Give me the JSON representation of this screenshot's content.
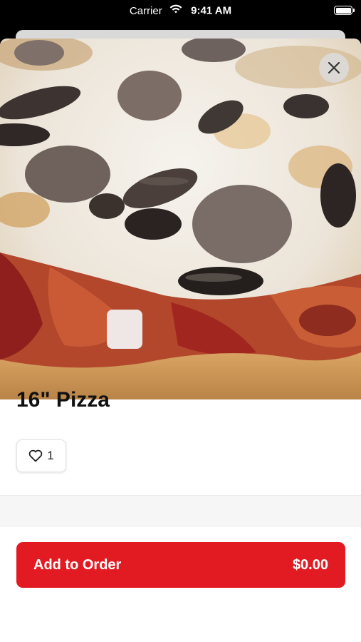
{
  "status_bar": {
    "carrier": "Carrier",
    "time": "9:41 AM",
    "icons": [
      "wifi-icon",
      "battery-icon"
    ]
  },
  "product": {
    "image_description_icon": "pizza-photo",
    "title": "16\" Pizza",
    "likes_count": "1"
  },
  "actions": {
    "close_icon": "close-icon",
    "like_icon": "heart-icon",
    "add_to_order_label": "Add to Order",
    "price": "$0.00"
  },
  "colors": {
    "accent": "#e21b23",
    "sheet_background": "#ffffff",
    "status_bar_background": "#000000"
  }
}
